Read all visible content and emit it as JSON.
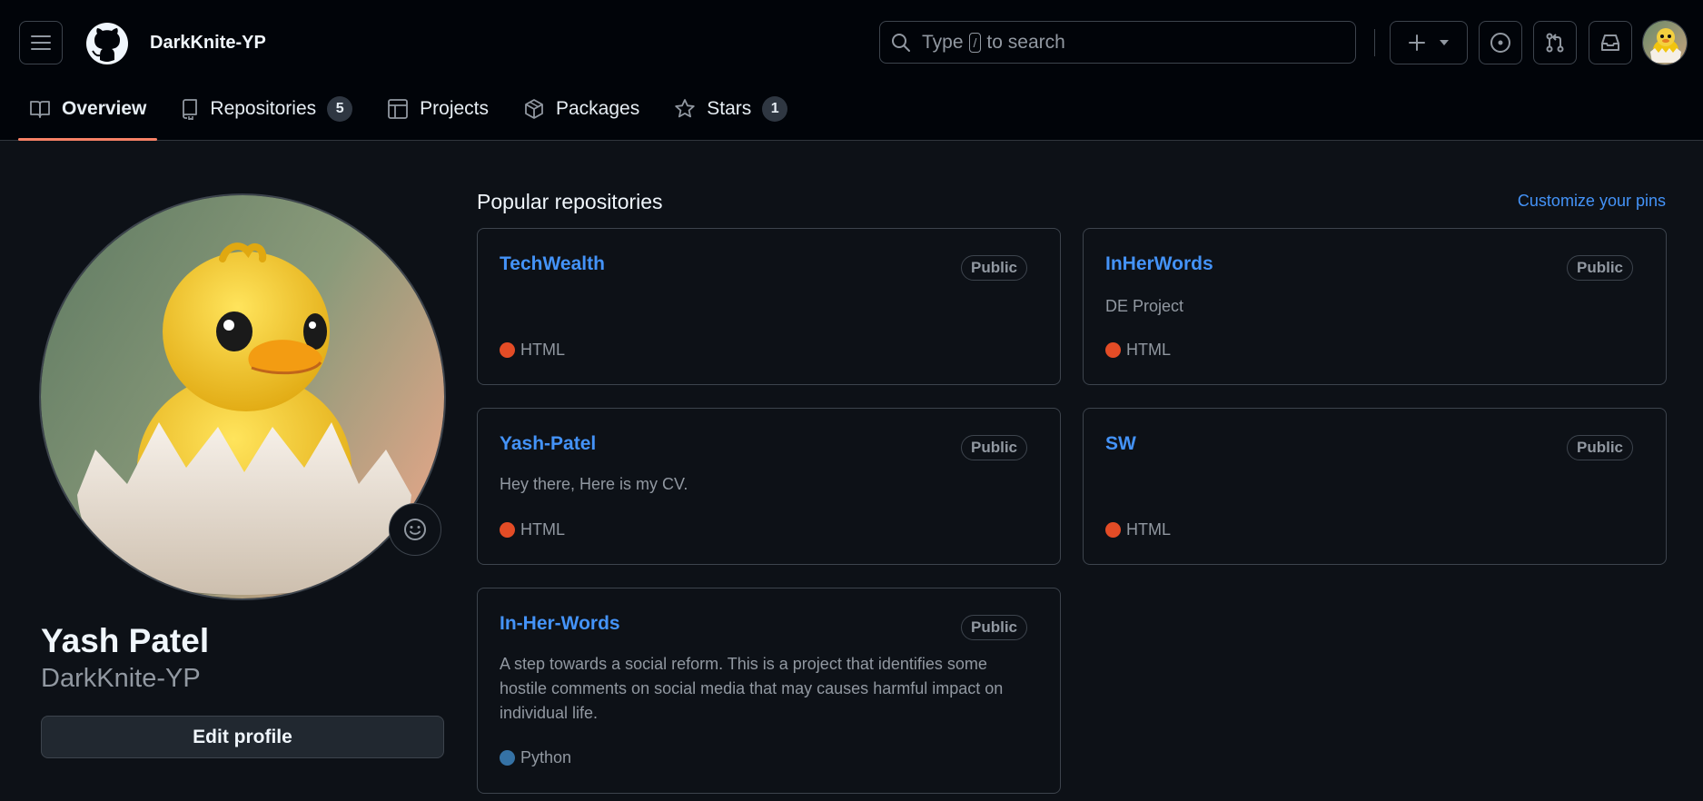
{
  "header": {
    "username": "DarkKnite-YP",
    "search_prefix": "Type",
    "search_key": "/",
    "search_suffix": "to search"
  },
  "tabs": [
    {
      "label": "Overview",
      "icon": "book-icon",
      "active": true
    },
    {
      "label": "Repositories",
      "icon": "repo-icon",
      "count": "5"
    },
    {
      "label": "Projects",
      "icon": "table-icon"
    },
    {
      "label": "Packages",
      "icon": "package-icon"
    },
    {
      "label": "Stars",
      "icon": "star-icon",
      "count": "1"
    }
  ],
  "profile": {
    "full_name": "Yash Patel",
    "login": "DarkKnite-YP",
    "edit_label": "Edit profile"
  },
  "popular": {
    "title": "Popular repositories",
    "customize": "Customize your pins",
    "repos": [
      {
        "name": "TechWealth",
        "visibility": "Public",
        "description": "",
        "language": "HTML",
        "language_color": "#e34c26"
      },
      {
        "name": "InHerWords",
        "visibility": "Public",
        "description": "DE Project",
        "language": "HTML",
        "language_color": "#e34c26"
      },
      {
        "name": "Yash-Patel",
        "visibility": "Public",
        "description": "Hey there, Here is my CV.",
        "language": "HTML",
        "language_color": "#e34c26"
      },
      {
        "name": "SW",
        "visibility": "Public",
        "description": "",
        "language": "HTML",
        "language_color": "#e34c26"
      },
      {
        "name": "In-Her-Words",
        "visibility": "Public",
        "description": "A step towards a social reform. This is a project that identifies some hostile comments on social media that may causes harmful impact on individual life.",
        "language": "Python",
        "language_color": "#3572A5"
      }
    ]
  },
  "colors": {
    "background": "#0d1117",
    "header": "#010409",
    "link": "#4493f8",
    "tab_underline": "#f78166"
  }
}
